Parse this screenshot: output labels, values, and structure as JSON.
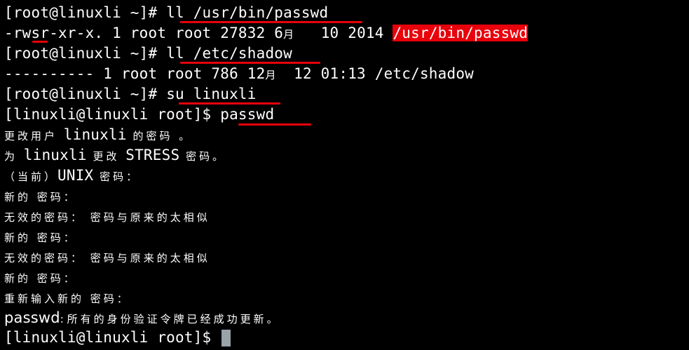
{
  "terminal": {
    "lines": [
      {
        "prompt": "[root@linuxli ~]# ",
        "command": "ll /usr/bin/passwd"
      },
      {
        "perm": "-rwsr-xr-x.",
        "rest": " 1 root root 27832 6",
        "month": "月",
        "rest2": "   10 2014 ",
        "highlight": "/usr/bin/passwd"
      },
      {
        "prompt": "[root@linuxli ~]# ",
        "command": "ll /etc/shadow"
      },
      {
        "text": "---------- 1 root root 786 12",
        "month": "月",
        "rest2": "  12 01:13 /etc/shadow"
      },
      {
        "prompt": "[root@linuxli ~]# ",
        "command": "su linuxli"
      },
      {
        "prompt": "[linuxli@linuxli root]$ ",
        "command": "passwd"
      },
      {
        "a": "更改用户 ",
        "b": "linuxli",
        "c": " 的密码 。"
      },
      {
        "a": "为 ",
        "b": "linuxli",
        "c": " 更改 ",
        "d": "STRESS",
        "e": " 密码。"
      },
      {
        "a": "（当前）",
        "b": "UNIX",
        "c": " 密码："
      },
      {
        "text": "新的 密码："
      },
      {
        "text": "无效的密码： 密码与原来的太相似"
      },
      {
        "text": "新的 密码："
      },
      {
        "text": "无效的密码： 密码与原来的太相似"
      },
      {
        "text": "新的 密码："
      },
      {
        "text": "重新输入新的 密码："
      },
      {
        "a": "passwd",
        "b": ": ",
        "c": "所有的身份验证令牌已经成功更新。"
      },
      {
        "prompt": "[linuxli@linuxli root]$ "
      }
    ]
  },
  "colors": {
    "background": "#000000",
    "text": "#ffffff",
    "annotation_red": "#e8000b",
    "cursor": "#9aa3a8"
  }
}
